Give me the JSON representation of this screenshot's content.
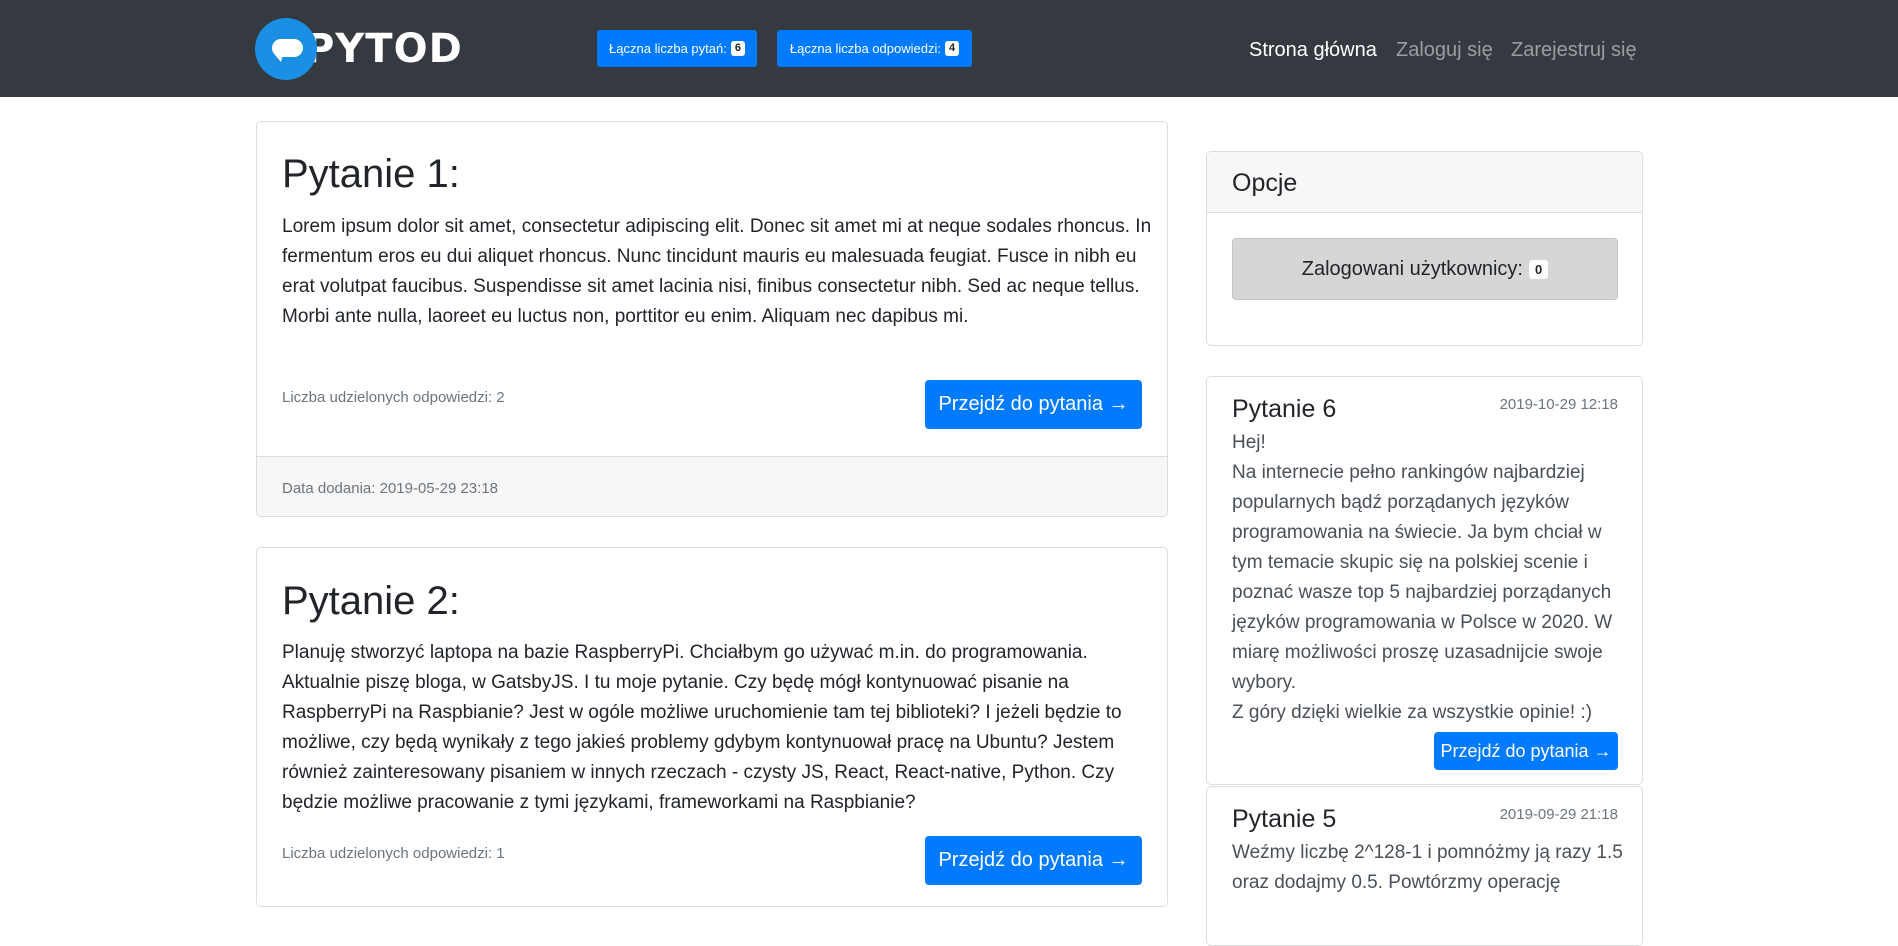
{
  "navbar": {
    "logo_text": "PYTOD",
    "total_questions_label": "Łączna liczba pytań:",
    "total_questions_count": "6",
    "total_answers_label": "Łączna liczba odpowiedzi:",
    "total_answers_count": "4",
    "links": [
      "Strona główna",
      "Zaloguj się",
      "Zarejestruj się"
    ]
  },
  "questions": [
    {
      "title": "Pytanie 1:",
      "body": "Lorem ipsum dolor sit amet, consectetur adipiscing elit. Donec sit amet mi at neque sodales rhoncus. In fermentum eros eu dui aliquet rhoncus. Nunc tincidunt mauris eu malesuada feugiat. Fusce in nibh eu erat volutpat faucibus. Suspendisse sit amet lacinia nisi, finibus consectetur nibh. Sed ac neque tellus. Morbi ante nulla, laoreet eu luctus non, porttitor eu enim. Aliquam nec dapibus mi.",
      "answers": "Liczba udzielonych odpowiedzi: 2",
      "button": "Przejdź do pytania →",
      "date": "Data dodania: 2019-05-29 23:18"
    },
    {
      "title": "Pytanie 2:",
      "body": "Planuję stworzyć laptopa na bazie RaspberryPi. Chciałbym go używać m.in. do programowania. Aktualnie piszę bloga, w GatsbyJS. I tu moje pytanie. Czy będę mógł kontynuować pisanie na RaspberryPi na Raspbianie? Jest w ogóle możliwe uruchomienie tam tej biblioteki? I jeżeli będzie to możliwe, czy będą wynikały z tego jakieś problemy gdybym kontynuował pracę na Ubuntu? Jestem również zainteresowany pisaniem w innych rzeczach - czysty JS, React, React-native, Python. Czy będzie możliwe pracowanie z tymi językami, frameworkami na Raspbianie?",
      "answers": "Liczba udzielonych odpowiedzi: 1",
      "button": "Przejdź do pytania →"
    }
  ],
  "options": {
    "title": "Opcje",
    "logged_users_label": "Zalogowani użytkownicy:",
    "logged_users_count": "0"
  },
  "sidebar_questions": [
    {
      "title": "Pytanie 6",
      "date": "2019-10-29 12:18",
      "body_lines": [
        "Hej!",
        "Na internecie pełno rankingów najbardziej popularnych bądź porządanych języków programowania na świecie. Ja bym chciał w tym temacie skupic się na polskiej scenie i poznać wasze top 5 najbardziej porządanych języków programowania w Polsce w 2020. W miarę możliwości proszę uzasadnijcie swoje wybory.",
        "Z góry dzięki wielkie za wszystkie opinie! :)"
      ],
      "button": "Przejdź do pytania →"
    },
    {
      "title": "Pytanie 5",
      "date": "2019-09-29 21:18",
      "body": "Weźmy liczbę 2^128-1 i pomnóżmy ją razy 1.5 oraz dodajmy 0.5. Powtórzmy operację"
    }
  ]
}
